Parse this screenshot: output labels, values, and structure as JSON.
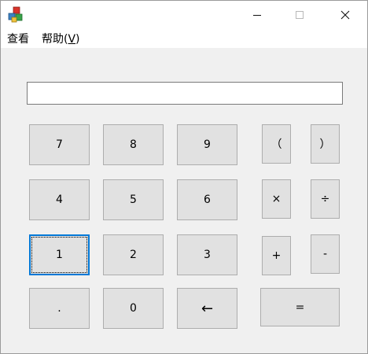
{
  "window": {
    "icon": "app-icon",
    "minimize_icon": "minimize-icon",
    "maximize_icon": "maximize-icon",
    "close_icon": "close-icon"
  },
  "menu": {
    "view_label": "查看",
    "help_label": "帮助(",
    "help_hotkey": "V",
    "help_close": ")"
  },
  "display": {
    "value": ""
  },
  "keys": {
    "seven": "7",
    "eight": "8",
    "nine": "9",
    "lparen": "（",
    "rparen": "）",
    "four": "4",
    "five": "5",
    "six": "6",
    "multiply": "×",
    "divide": "÷",
    "one": "1",
    "two": "2",
    "three": "3",
    "plus": "+",
    "minus": "-",
    "dot": ".",
    "zero": "0",
    "backspace": "←",
    "equals": "="
  },
  "colors": {
    "focus_accent": "#0078d7",
    "key_face": "#e1e1e1"
  }
}
